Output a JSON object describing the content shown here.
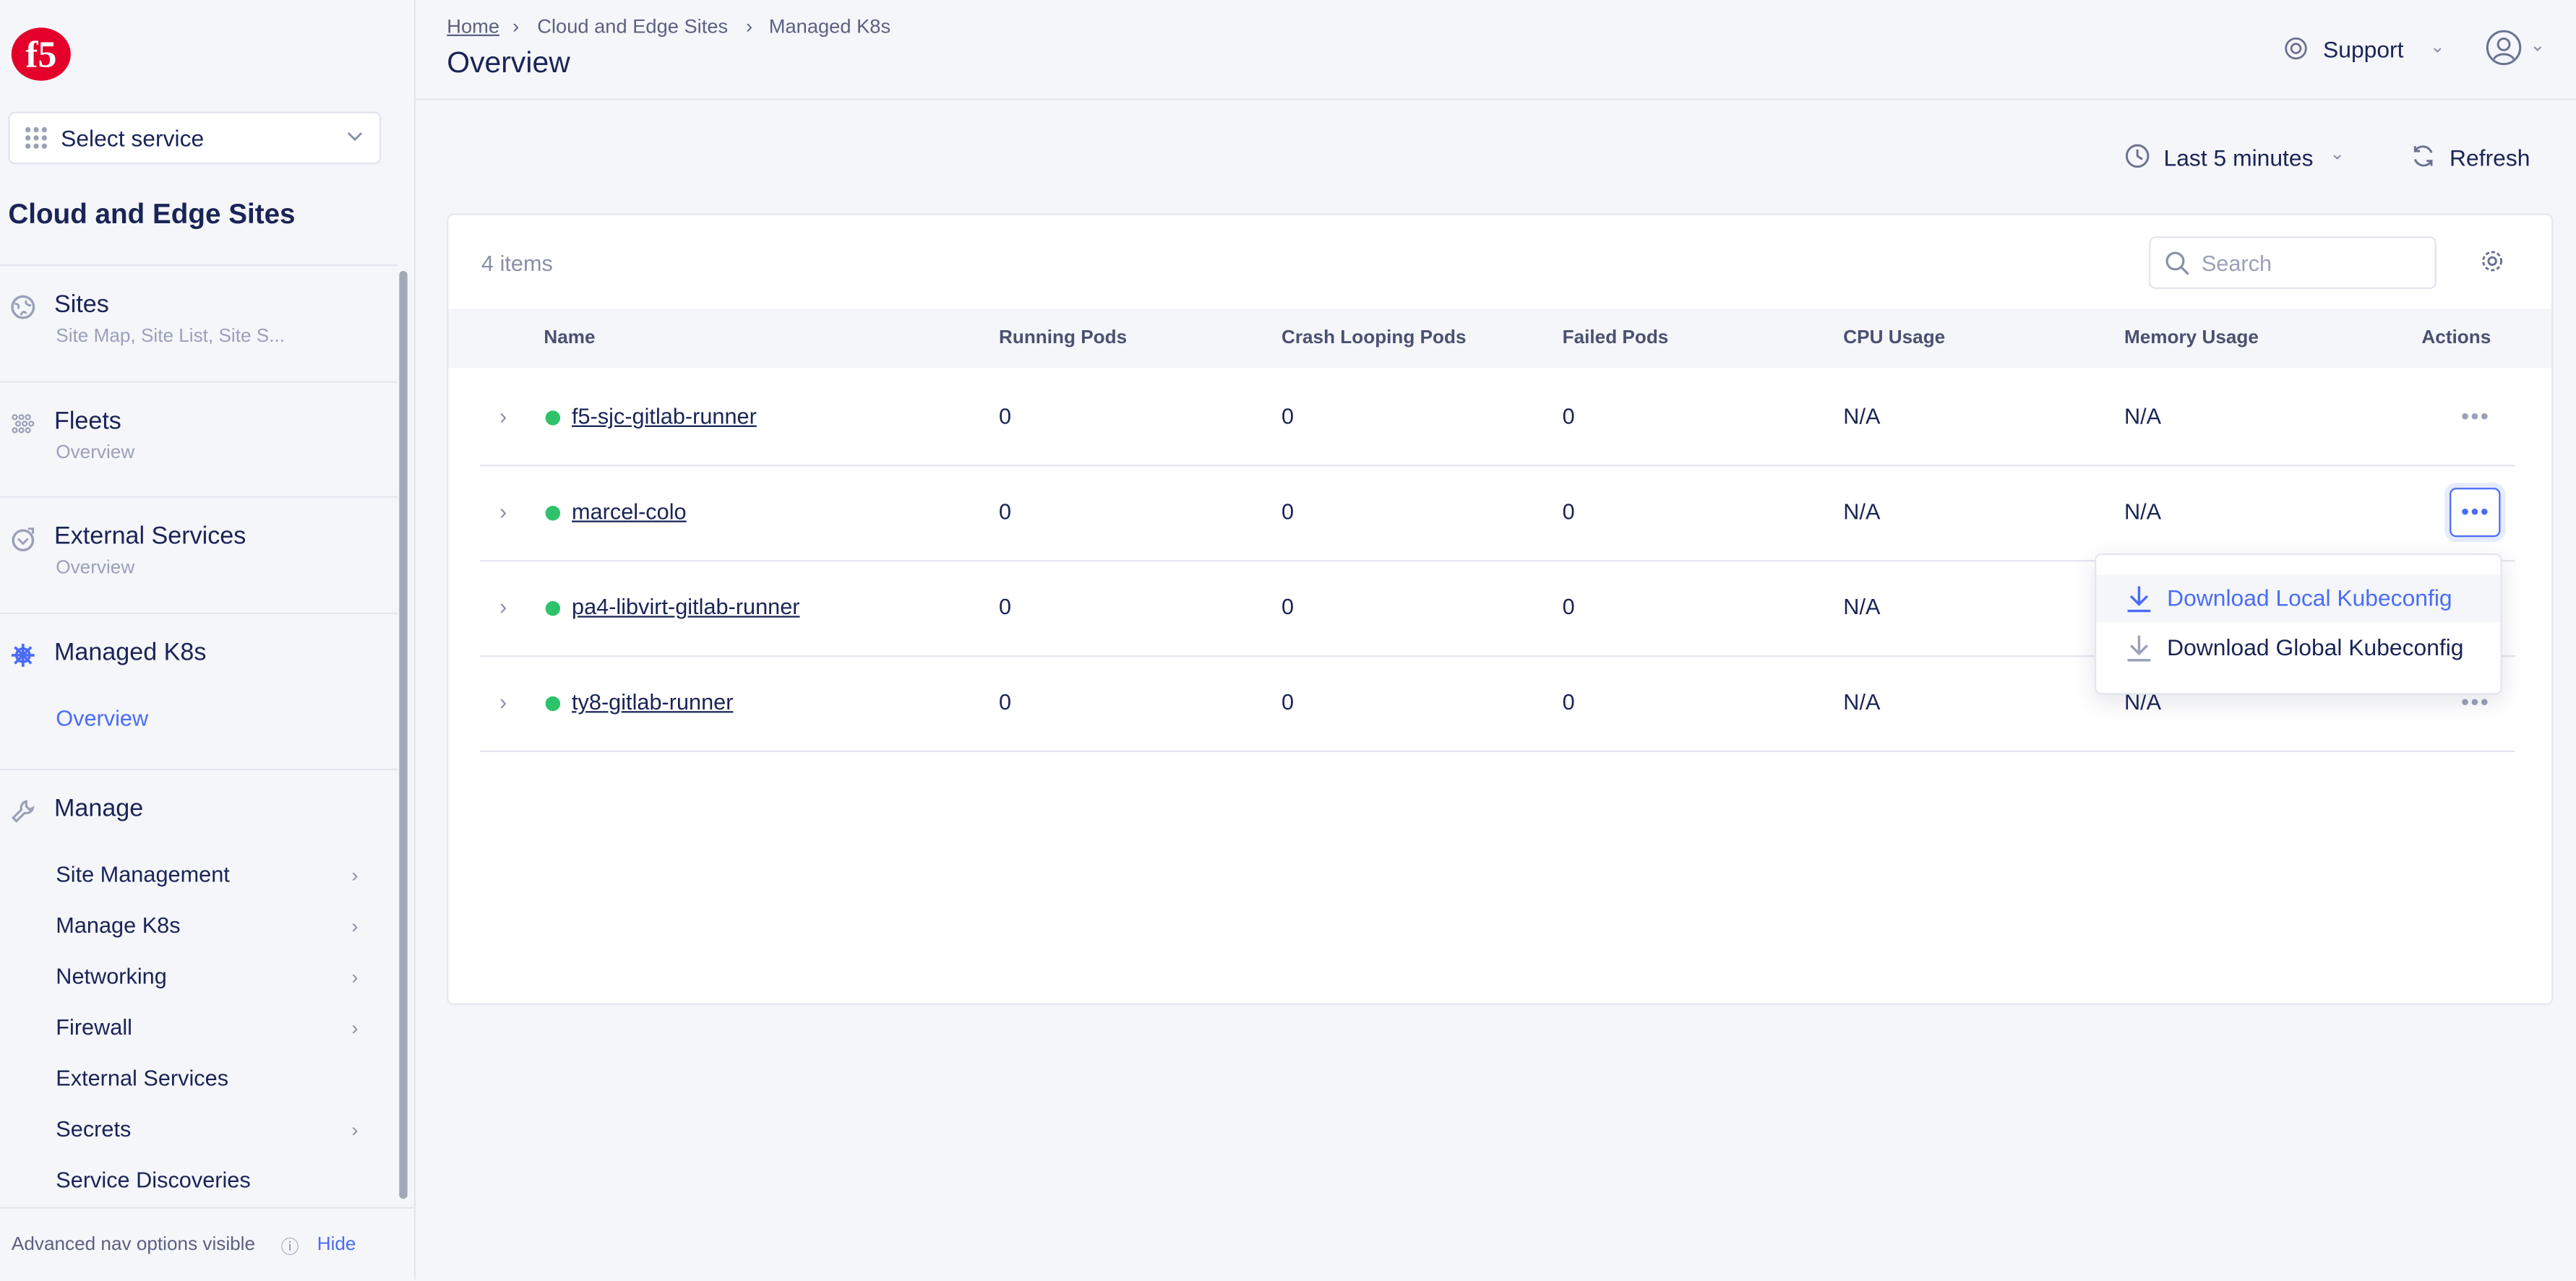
{
  "sidebar": {
    "logo_text": "f5",
    "service_select": "Select service",
    "section_title": "Cloud and Edge Sites",
    "nav": [
      {
        "label": "Sites",
        "sub": "Site Map, Site List, Site S...",
        "icon": "globe-icon"
      },
      {
        "label": "Fleets",
        "sub": "Overview",
        "icon": "fleet-icon"
      },
      {
        "label": "External Services",
        "sub": "Overview",
        "icon": "external-services-icon"
      },
      {
        "label": "Managed K8s",
        "sub": "Overview",
        "icon": "helm-icon",
        "active": true
      }
    ],
    "manage": {
      "label": "Manage",
      "items": [
        {
          "label": "Site Management",
          "chevron": true
        },
        {
          "label": "Manage K8s",
          "chevron": true
        },
        {
          "label": "Networking",
          "chevron": true
        },
        {
          "label": "Firewall",
          "chevron": true
        },
        {
          "label": "External Services",
          "chevron": false
        },
        {
          "label": "Secrets",
          "chevron": true
        },
        {
          "label": "Service Discoveries",
          "chevron": false
        }
      ]
    },
    "footer": {
      "text": "Advanced nav options visible",
      "hide": "Hide"
    }
  },
  "header": {
    "breadcrumb": [
      "Home",
      "Cloud and Edge Sites",
      "Managed K8s"
    ],
    "title": "Overview",
    "support": "Support"
  },
  "toolbar": {
    "time_range": "Last 5 minutes",
    "refresh": "Refresh"
  },
  "table": {
    "count": "4 items",
    "search_placeholder": "Search",
    "columns": [
      "Name",
      "Running Pods",
      "Crash Looping Pods",
      "Failed Pods",
      "CPU Usage",
      "Memory Usage",
      "Actions"
    ],
    "rows": [
      {
        "name": "f5-sjc-gitlab-runner",
        "running": "0",
        "crash": "0",
        "failed": "0",
        "cpu": "N/A",
        "memory": "N/A",
        "status": "online"
      },
      {
        "name": "marcel-colo",
        "running": "0",
        "crash": "0",
        "failed": "0",
        "cpu": "N/A",
        "memory": "N/A",
        "status": "online"
      },
      {
        "name": "pa4-libvirt-gitlab-runner",
        "running": "0",
        "crash": "0",
        "failed": "0",
        "cpu": "N/A",
        "memory": "",
        "status": "online"
      },
      {
        "name": "ty8-gitlab-runner",
        "running": "0",
        "crash": "0",
        "failed": "0",
        "cpu": "N/A",
        "memory": "N/A",
        "status": "online"
      }
    ]
  },
  "actions_menu": {
    "items": [
      "Download Local Kubeconfig",
      "Download Global Kubeconfig"
    ]
  },
  "colors": {
    "accent": "#4a6cf7",
    "status_online": "#2ec36b",
    "text": "#1a2456",
    "brand": "#e4002b"
  }
}
